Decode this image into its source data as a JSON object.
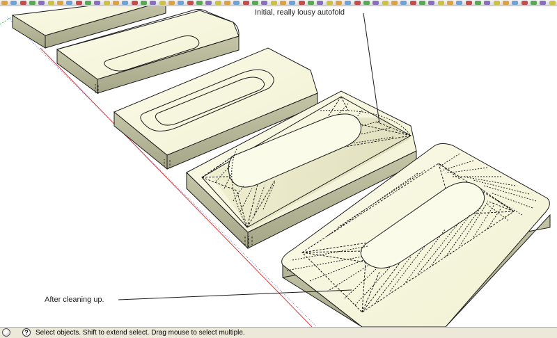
{
  "toolbar": {
    "icon_names": [
      "select-icon",
      "eraser-icon",
      "paint-icon",
      "rectangle-icon",
      "line-icon",
      "circle-icon",
      "arc-icon",
      "polygon-icon",
      "freehand-icon",
      "push-pull-icon",
      "follow-me-icon",
      "offset-icon",
      "move-icon",
      "rotate-icon",
      "scale-icon",
      "tape-measure-icon",
      "dimension-icon",
      "protractor-icon",
      "text-icon",
      "axes-icon",
      "3d-text-icon",
      "section-plane-icon",
      "orbit-icon",
      "pan-icon",
      "zoom-icon",
      "zoom-window-icon",
      "zoom-extents-icon",
      "previous-view-icon",
      "next-view-icon",
      "walk-icon",
      "look-around-icon",
      "position-camera-icon",
      "iso-view-icon",
      "top-view-icon",
      "front-view-icon",
      "right-view-icon",
      "back-view-icon",
      "left-view-icon",
      "xray-icon",
      "wireframe-icon",
      "hidden-line-icon",
      "shaded-icon",
      "textured-icon",
      "monochrome-icon",
      "sandbox-icon",
      "components-icon",
      "materials-icon",
      "styles-icon",
      "shadows-icon",
      "fog-icon",
      "layers-icon",
      "outliner-icon",
      "scenes-icon",
      "model-info-icon",
      "play-icon",
      "export-icon",
      "warehouse-icon",
      "share-icon",
      "earth-icon",
      "photo-icon"
    ]
  },
  "annotations": {
    "top": "Initial, really lousy autofold",
    "bottom": "After cleaning up."
  },
  "statusbar": {
    "text": "Select objects. Shift to extend select. Drag mouse to select multiple."
  },
  "colors": {
    "face": "#f8f8e2",
    "side": "#b8b89a",
    "edge": "#1a1a1a",
    "red_axis": "#e03c3c",
    "blue_axis": "#6f7ed8",
    "green_axis": "#3cb45a",
    "status_bg": "#ece9d8"
  }
}
